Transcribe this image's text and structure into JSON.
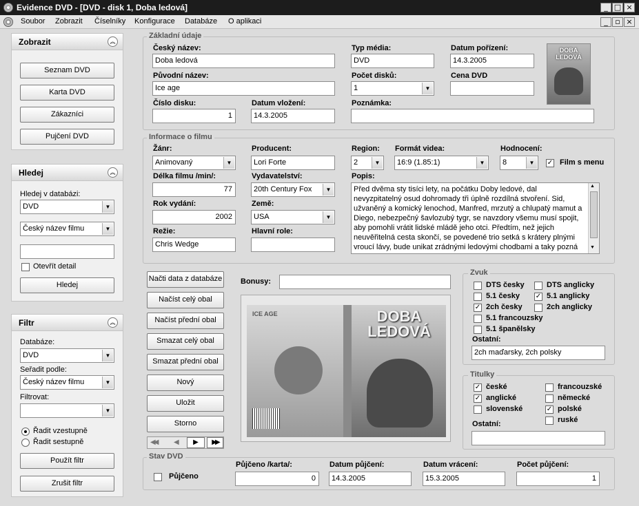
{
  "window": {
    "title": "Evidence DVD - [DVD - disk 1, Doba ledová]",
    "min": "_",
    "max": "□",
    "close": "×",
    "mdi_min": "_",
    "mdi_restore": "▫",
    "mdi_close": "×"
  },
  "menu": {
    "items": [
      "Soubor",
      "Zobrazit",
      "Číselníky",
      "Konfigurace",
      "Databáze",
      "O aplikaci"
    ]
  },
  "left": {
    "zobrazit": {
      "title": "Zobrazit",
      "buttons": [
        "Seznam DVD",
        "Karta DVD",
        "Zákazníci",
        "Pujčení DVD"
      ]
    },
    "hledej": {
      "title": "Hledej",
      "db_label": "Hledej v databázi:",
      "db_value": "DVD",
      "field_value": "Český název filmu",
      "search_value": "",
      "detail_label": "Otevřít detail",
      "detail_checked": false,
      "button": "Hledej"
    },
    "filtr": {
      "title": "Filtr",
      "db_label": "Databáze:",
      "db_value": "DVD",
      "sort_label": "Seřadit podle:",
      "sort_value": "Český název filmu",
      "filter_label": "Filtrovat:",
      "filter_value": "",
      "asc_label": "Řadit vzestupně",
      "desc_label": "Řadit sestupně",
      "sort_dir": "asc",
      "apply": "Použít filtr",
      "cancel": "Zrušit filtr"
    }
  },
  "basic": {
    "legend": "Základní údaje",
    "cz_label": "Český název:",
    "cz_value": "Doba ledová",
    "orig_label": "Původní název:",
    "orig_value": "Ice age",
    "disc_label": "Číslo disku:",
    "disc_value": "1",
    "inserted_label": "Datum vložení:",
    "inserted_value": "14.3.2005",
    "media_label": "Typ média:",
    "media_value": "DVD",
    "count_label": "Počet disků:",
    "count_value": "1",
    "note_label": "Poznámka:",
    "note_value": "",
    "acq_label": "Datum pořízení:",
    "acq_value": "14.3.2005",
    "price_label": "Cena DVD",
    "price_value": "",
    "thumb_text": "DOBA LEDOVÁ"
  },
  "film": {
    "legend": "Informace o filmu",
    "genre_label": "Žánr:",
    "genre_value": "Animovaný",
    "length_label": "Délka filmu /min/:",
    "length_value": "77",
    "year_label": "Rok vydání:",
    "year_value": "2002",
    "director_label": "Režie:",
    "director_value": "Chris Wedge",
    "producer_label": "Producent:",
    "producer_value": "Lori Forte",
    "publisher_label": "Vydavatelství:",
    "publisher_value": "20th Century Fox",
    "country_label": "Země:",
    "country_value": "USA",
    "roles_label": "Hlavní role:",
    "roles_value": "",
    "region_label": "Region:",
    "region_value": "2",
    "format_label": "Formát videa:",
    "format_value": "16:9 (1.85:1)",
    "rating_label": "Hodnocení:",
    "rating_value": "8",
    "menu_label": "Film s menu",
    "menu_checked": true,
    "desc_label": "Popis:",
    "desc_value": "Před dvěma sty tisíci lety, na počátku Doby ledové, dal nevyzpitatelný osud dohromady tři úplně rozdílná stvoření. Sid, užvaněný a komický lenochod, Manfred, mrzutý a chlupatý mamut a Diego, nebezpečný šavlozubý tygr, se navzdory všemu musí spojit, aby pomohli vrátit lidské mládě jeho otci. Předtím, než jejich neuvěřitelná cesta skončí, se povedené trio setká s krátery plnými vroucí lávy, bude unikat zrádnými ledovými chodbami a taky pozná prehistorickou veverku, jménem Scrat,"
  },
  "actions": [
    "Načti data z databáze",
    "Načíst celý obal",
    "Načíst přední obal",
    "Smazat celý obal",
    "Smazat přední obal",
    "Nový",
    "Uložit",
    "Storno"
  ],
  "nav": {
    "first": "◀◀",
    "prev": "◀",
    "next": "▶",
    "last": "▶▶"
  },
  "bonus": {
    "label": "Bonusy:",
    "value": ""
  },
  "cover": {
    "front_title": "DOBA LEDOVÁ",
    "back_text": "ICE AGE"
  },
  "zvuk": {
    "legend": "Zvuk",
    "items": [
      {
        "label": "DTS česky",
        "checked": false
      },
      {
        "label": "DTS anglicky",
        "checked": false
      },
      {
        "label": "5.1 česky",
        "checked": false
      },
      {
        "label": "5.1 anglicky",
        "checked": true
      },
      {
        "label": "2ch česky",
        "checked": true
      },
      {
        "label": "2ch anglicky",
        "checked": false
      },
      {
        "label": "5.1 francouzsky",
        "checked": false
      },
      {
        "label": "5.1 španělsky",
        "checked": false
      }
    ],
    "other_label": "Ostatní:",
    "other_value": "2ch maďarsky, 2ch polsky"
  },
  "titulky": {
    "legend": "Titulky",
    "items": [
      {
        "label": "české",
        "checked": true
      },
      {
        "label": "francouzské",
        "checked": false
      },
      {
        "label": "anglické",
        "checked": true
      },
      {
        "label": "německé",
        "checked": false
      },
      {
        "label": "slovenské",
        "checked": false
      },
      {
        "label": "polské",
        "checked": true
      },
      {
        "label": "ruské",
        "checked": false
      }
    ],
    "other_label": "Ostatní:",
    "other_value": ""
  },
  "stav": {
    "legend": "Stav DVD",
    "borrowed_label": "Půjčeno",
    "borrowed_checked": false,
    "card_label": "Půjčeno /karta/:",
    "card_value": "0",
    "loan_label": "Datum půjčení:",
    "loan_value": "14.3.2005",
    "return_label": "Datum vrácení:",
    "return_value": "15.3.2005",
    "count_label": "Počet půjčení:",
    "count_value": "1"
  }
}
